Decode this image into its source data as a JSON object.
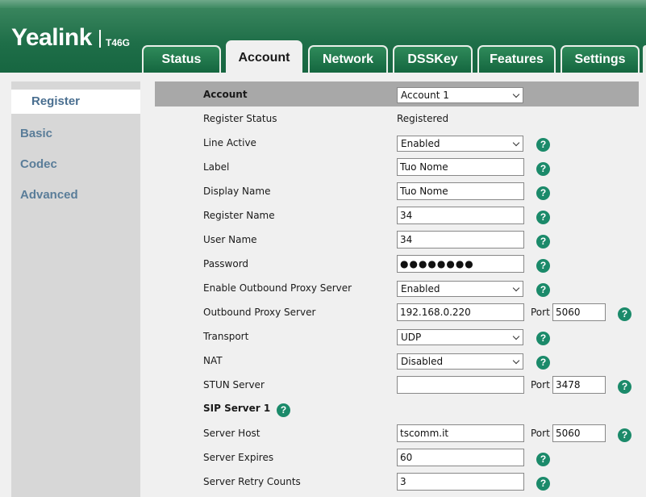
{
  "brand": {
    "name": "Yealink",
    "model": "T46G"
  },
  "tabs": [
    "Status",
    "Account",
    "Network",
    "DSSKey",
    "Features",
    "Settings"
  ],
  "active_tab": "Account",
  "sidebar": {
    "items": [
      "Register",
      "Basic",
      "Codec",
      "Advanced"
    ],
    "active": "Register"
  },
  "form": {
    "account_label": "Account",
    "account_value": "Account 1",
    "register_status_label": "Register Status",
    "register_status_value": "Registered",
    "line_active_label": "Line Active",
    "line_active_value": "Enabled",
    "label_label": "Label",
    "label_value": "Tuo Nome",
    "display_name_label": "Display Name",
    "display_name_value": "Tuo Nome",
    "register_name_label": "Register Name",
    "register_name_value": "34",
    "user_name_label": "User Name",
    "user_name_value": "34",
    "password_label": "Password",
    "password_value": "●●●●●●●●",
    "outbound_proxy_enable_label": "Enable Outbound Proxy Server",
    "outbound_proxy_enable_value": "Enabled",
    "outbound_proxy_label": "Outbound Proxy Server",
    "outbound_proxy_value": "192.168.0.220",
    "outbound_proxy_port": "5060",
    "transport_label": "Transport",
    "transport_value": "UDP",
    "nat_label": "NAT",
    "nat_value": "Disabled",
    "stun_label": "STUN Server",
    "stun_value": "",
    "stun_port": "3478",
    "sip_server_label": "SIP Server 1",
    "server_host_label": "Server Host",
    "server_host_value": "tscomm.it",
    "server_host_port": "5060",
    "server_expires_label": "Server Expires",
    "server_expires_value": "60",
    "server_retry_label": "Server Retry Counts",
    "server_retry_value": "3",
    "port_label": "Port",
    "help_glyph": "?"
  },
  "colors": {
    "header_green": "#1e6e48",
    "help_icon": "#1b8a6a",
    "sidebar_link": "#5a7d99"
  }
}
